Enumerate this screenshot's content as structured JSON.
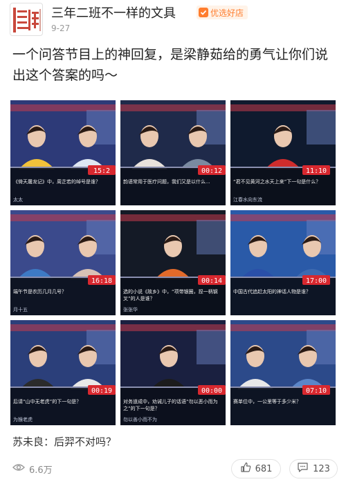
{
  "author": {
    "avatar_text": "三年二班",
    "name": "三年二班不一样的文具",
    "badge_label": "优选好店",
    "date": "9-27"
  },
  "post": {
    "text": "一个问答节目上的神回复，是梁静茹给的勇气让你们说出这个答案的吗～"
  },
  "grid": {
    "tiles": [
      {
        "clock": "15:2",
        "caption": "《倚天屠龙记》中，周芷若的绰号是谁？",
        "extra": "太太"
      },
      {
        "clock": "00:12",
        "caption": "韵语常用于医疗问题，我们又是以什么..."
      },
      {
        "clock": "11:10",
        "caption": "“君不见黄河之水天上来”下一句是什么？",
        "extra": "江春水向东流"
      },
      {
        "clock": "16:18",
        "caption": "端午节是农历几月几号？",
        "extra": "月十五"
      },
      {
        "clock": "00:14",
        "caption": "选的小说《故乡》中，“项带银圈，捏一柄钢叉”的人是谁？",
        "extra": "张张华"
      },
      {
        "clock": "17:00",
        "caption": "中国古代追赶太阳的神话人物是谁？"
      },
      {
        "clock": "00:19",
        "caption": "后请“山中无老虎”的下一句是？",
        "extra": "为猴老虎"
      },
      {
        "clock": "00:00",
        "caption": "对务道成中，劝诫儿子的话语“勿以恶小而为之”的下一句是？",
        "extra": "勿以善小而不为"
      },
      {
        "clock": "07:10",
        "caption": "赛单位中，一公里等于多少米？"
      }
    ]
  },
  "comment": {
    "commenter": "苏未良",
    "separator": "：",
    "text": "后羿不对吗？"
  },
  "footer": {
    "views": "6.6万",
    "likes": "681",
    "comments": "123"
  },
  "colors": {
    "accent_orange": "#ff7d2e",
    "avatar_red": "#c9483c",
    "timer_red": "#d8282f"
  }
}
